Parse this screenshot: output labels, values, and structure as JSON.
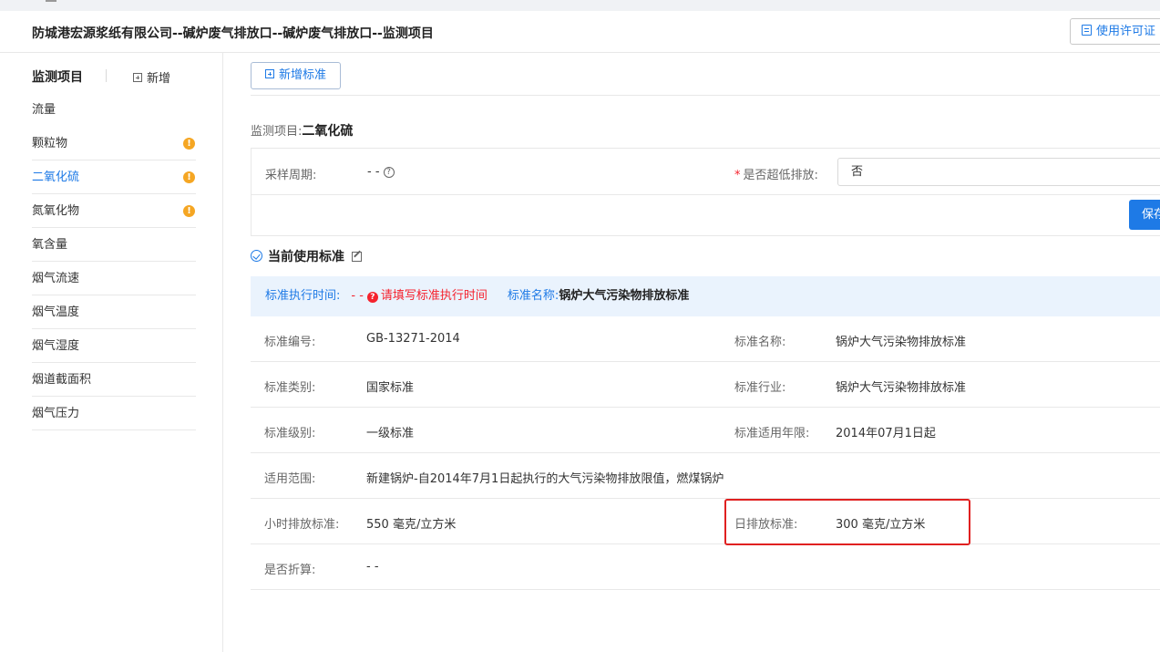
{
  "header": {
    "title": "防城港宏源浆纸有限公司--碱炉废气排放口--碱炉废气排放口--监测项目",
    "license_button": "使用许可证"
  },
  "sidebar": {
    "title": "监测项目",
    "add_label": "新增",
    "items": [
      {
        "label": "流量",
        "warning": false
      },
      {
        "label": "颗粒物",
        "warning": true
      },
      {
        "label": "二氧化硫",
        "warning": true,
        "active": true
      },
      {
        "label": "氮氧化物",
        "warning": true
      },
      {
        "label": "氧含量",
        "warning": false
      },
      {
        "label": "烟气流速",
        "warning": false
      },
      {
        "label": "烟气温度",
        "warning": false
      },
      {
        "label": "烟气湿度",
        "warning": false
      },
      {
        "label": "烟道截面积",
        "warning": false
      },
      {
        "label": "烟气压力",
        "warning": false
      }
    ]
  },
  "main": {
    "new_standard_button": "新增标准",
    "project_label": "监测项目:",
    "project_value": "二氧化硫",
    "form": {
      "sampling_period_label": "采样周期:",
      "sampling_period_value": "- -",
      "ultra_low_label": "是否超低排放:",
      "ultra_low_value": "否",
      "save_button": "保存"
    },
    "current_standard_title": "当前使用标准",
    "info_bar": {
      "exec_time_label": "标准执行时间:",
      "exec_time_value": "- -",
      "exec_time_error": "请填写标准执行时间",
      "std_name_label": "标准名称:",
      "std_name_value": "锅炉大气污染物排放标准"
    },
    "details": {
      "std_no_label": "标准编号:",
      "std_no_value": "GB-13271-2014",
      "std_name_label": "标准名称:",
      "std_name_value": "锅炉大气污染物排放标准",
      "std_type_label": "标准类别:",
      "std_type_value": "国家标准",
      "std_industry_label": "标准行业:",
      "std_industry_value": "锅炉大气污染物排放标准",
      "std_level_label": "标准级别:",
      "std_level_value": "一级标准",
      "std_years_label": "标准适用年限:",
      "std_years_value": "2014年07月1日起",
      "scope_label": "适用范围:",
      "scope_value": "新建锅炉-自2014年7月1日起执行的大气污染物排放限值，燃煤锅炉",
      "hourly_label": "小时排放标准:",
      "hourly_value": "550 毫克/立方米",
      "daily_label": "日排放标准:",
      "daily_value": "300 毫克/立方米",
      "converted_label": "是否折算:",
      "converted_value": "- -"
    }
  },
  "colors": {
    "accent": "#1e7ae6",
    "warning": "#f5a623",
    "error": "#f5222d",
    "highlight_box": "#e02020"
  }
}
